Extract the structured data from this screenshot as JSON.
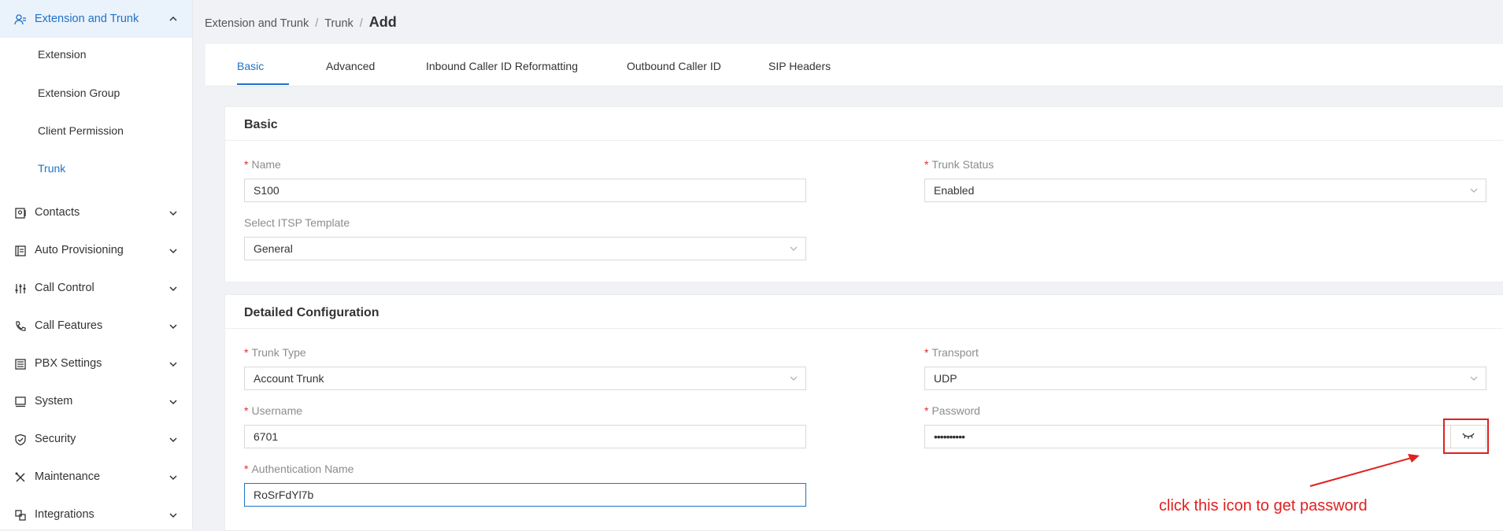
{
  "sidebar": {
    "group": {
      "label": "Extension and Trunk",
      "icon": "users-icon",
      "chevron": "chevron-up-icon"
    },
    "subitems": [
      {
        "label": "Extension",
        "active": false
      },
      {
        "label": "Extension Group",
        "active": false
      },
      {
        "label": "Client Permission",
        "active": false
      },
      {
        "label": "Trunk",
        "active": true
      }
    ],
    "items": [
      {
        "label": "Contacts",
        "icon": "contacts-icon"
      },
      {
        "label": "Auto Provisioning",
        "icon": "provisioning-icon"
      },
      {
        "label": "Call Control",
        "icon": "sliders-icon"
      },
      {
        "label": "Call Features",
        "icon": "phone-icon"
      },
      {
        "label": "PBX Settings",
        "icon": "list-icon"
      },
      {
        "label": "System",
        "icon": "monitor-icon"
      },
      {
        "label": "Security",
        "icon": "shield-icon"
      },
      {
        "label": "Maintenance",
        "icon": "tools-icon"
      },
      {
        "label": "Integrations",
        "icon": "integrations-icon"
      }
    ],
    "accent_color": "#1f72c6"
  },
  "breadcrumb": {
    "item1": "Extension and Trunk",
    "item2": "Trunk",
    "current": "Add",
    "sep": "/"
  },
  "tabs": [
    {
      "label": "Basic",
      "active": true
    },
    {
      "label": "Advanced",
      "active": false
    },
    {
      "label": "Inbound Caller ID Reformatting",
      "active": false
    },
    {
      "label": "Outbound Caller ID",
      "active": false
    },
    {
      "label": "SIP Headers",
      "active": false
    }
  ],
  "basic": {
    "title": "Basic",
    "name": {
      "label": "Name",
      "value": "S100"
    },
    "trunk_status": {
      "label": "Trunk Status",
      "value": "Enabled"
    },
    "itsp_template": {
      "label": "Select ITSP Template",
      "value": "General"
    }
  },
  "detailed": {
    "title": "Detailed Configuration",
    "trunk_type": {
      "label": "Trunk Type",
      "value": "Account Trunk"
    },
    "transport": {
      "label": "Transport",
      "value": "UDP"
    },
    "username": {
      "label": "Username",
      "value": "6701"
    },
    "password": {
      "label": "Password",
      "value": "••••••••••",
      "icon": "eye-closed-icon"
    },
    "auth_name": {
      "label": "Authentication Name",
      "value": "RoSrFdYl7b"
    }
  },
  "annotation": {
    "text": "click this icon to get password",
    "color": "#e02020"
  }
}
